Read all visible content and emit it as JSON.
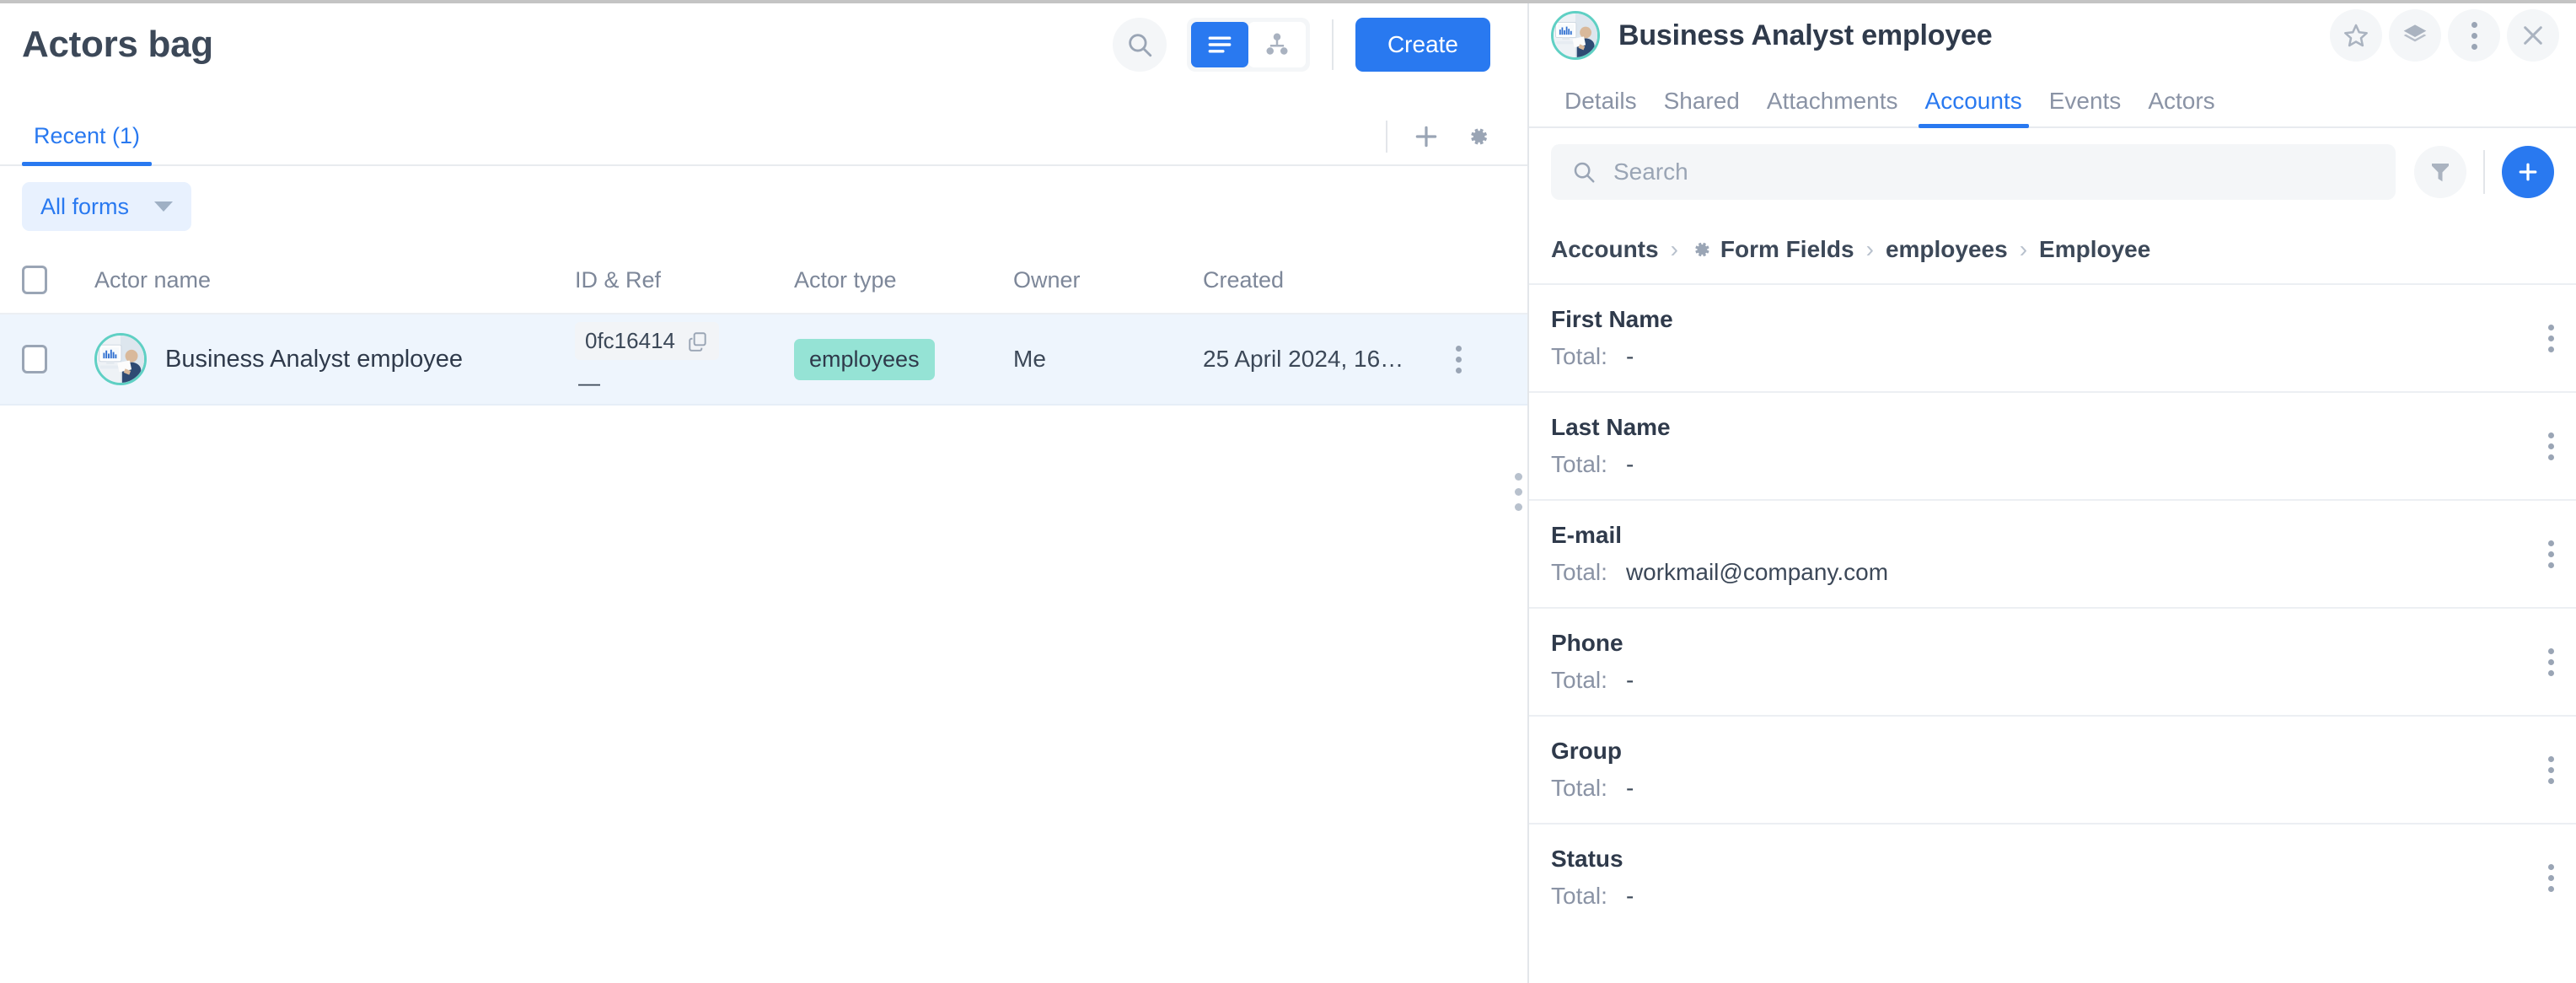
{
  "left": {
    "title": "Actors bag",
    "toolbar": {
      "search_icon": "search-icon",
      "view_list_icon": "list-view-icon",
      "view_tree_icon": "tree-view-icon",
      "create_label": "Create"
    },
    "tabs": [
      {
        "label": "Recent (1)",
        "active": true
      }
    ],
    "tab_tools": {
      "add_icon": "plus-icon",
      "settings_icon": "gear-icon"
    },
    "filter_chip": {
      "label": "All forms"
    },
    "table": {
      "columns": [
        "Actor name",
        "ID & Ref",
        "Actor type",
        "Owner",
        "Created"
      ],
      "rows": [
        {
          "name": "Business Analyst employee",
          "id": "0fc16414",
          "ref": "—",
          "type": "employees",
          "owner": "Me",
          "created": "25 April 2024, 16…",
          "copy_icon": "copy-icon",
          "menu_icon": "kebab-menu-icon"
        }
      ]
    }
  },
  "right": {
    "title": "Business Analyst employee",
    "header_icons": [
      {
        "name": "star-icon"
      },
      {
        "name": "layers-icon"
      },
      {
        "name": "kebab-menu-icon"
      },
      {
        "name": "close-icon"
      }
    ],
    "tabs": [
      {
        "label": "Details",
        "active": false
      },
      {
        "label": "Shared",
        "active": false
      },
      {
        "label": "Attachments",
        "active": false
      },
      {
        "label": "Accounts",
        "active": true
      },
      {
        "label": "Events",
        "active": false
      },
      {
        "label": "Actors",
        "active": false
      }
    ],
    "search": {
      "value": "",
      "placeholder": "Search"
    },
    "actions": {
      "filter_icon": "filter-funnel-icon",
      "add_icon": "plus-icon"
    },
    "breadcrumb": [
      {
        "label": "Accounts",
        "bold": true,
        "icon": null
      },
      {
        "label": "Form Fields",
        "bold": true,
        "icon": "gear-icon"
      },
      {
        "label": "employees",
        "bold": true,
        "icon": null
      },
      {
        "label": "Employee",
        "bold": true,
        "icon": null
      }
    ],
    "breadcrumb_separator": "›",
    "fields": [
      {
        "name": "First Name",
        "total_label": "Total:",
        "total_value": "-"
      },
      {
        "name": "Last Name",
        "total_label": "Total:",
        "total_value": "-"
      },
      {
        "name": "E-mail",
        "total_label": "Total:",
        "total_value": "workmail@company.com"
      },
      {
        "name": "Phone",
        "total_label": "Total:",
        "total_value": "-"
      },
      {
        "name": "Group",
        "total_label": "Total:",
        "total_value": "-"
      },
      {
        "name": "Status",
        "total_label": "Total:",
        "total_value": "-"
      }
    ]
  },
  "colors": {
    "accent_blue": "#2979f0",
    "badge_teal": "#95e3d5",
    "avatar_ring": "#5fd0c4",
    "text_dark": "#2f3a4b",
    "text_muted": "#8a93a5",
    "row_selected": "#eef5fd"
  }
}
